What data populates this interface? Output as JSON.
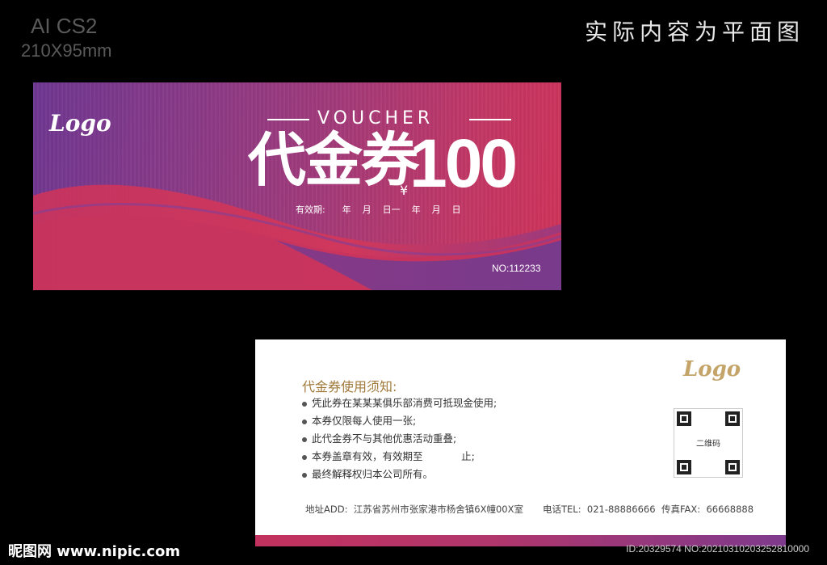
{
  "meta": {
    "software": "AI CS2",
    "size": "210X95mm",
    "note": "实际内容为平面图"
  },
  "front": {
    "logo": "Logo",
    "voucher_word": "VOUCHER",
    "title": "代金券",
    "currency": "¥",
    "amount": "100",
    "validity": "有效期:      年    月    日一    年    月    日",
    "serial": "NO:112233",
    "colors": {
      "gradient_start": "#6e3791",
      "gradient_end": "#cf3358"
    }
  },
  "back": {
    "logo": "Logo",
    "rules_title": "代金券使用须知:",
    "rules": [
      "凭此券在某某某俱乐部消费可抵现金使用;",
      "本券仅限每人使用一张;",
      "此代金券不与其他优惠活动重叠;",
      "本券盖章有效，有效期至            止;",
      "最终解释权归本公司所有。"
    ],
    "qr_label": "二维码",
    "address": "地址ADD:  江苏省苏州市张家港市杨舍镇6X幢00X室",
    "tel": "电话TEL:  021-88886666",
    "fax": "传真FAX:  66668888",
    "colors": {
      "title": "#a17a3c",
      "logo": "#c4a469"
    }
  },
  "watermark": {
    "site": "昵图网 www.nipic.com",
    "id": "ID:20329574 NO:20210310203252810000"
  }
}
